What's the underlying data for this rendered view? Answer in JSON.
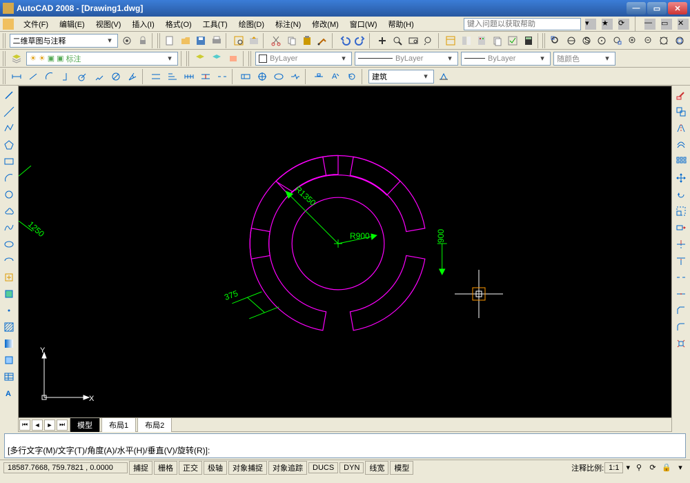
{
  "window": {
    "title": "AutoCAD 2008 - [Drawing1.dwg]",
    "help_placeholder": "键入问题以获取帮助"
  },
  "menus": [
    "文件(F)",
    "编辑(E)",
    "视图(V)",
    "插入(I)",
    "格式(O)",
    "工具(T)",
    "绘图(D)",
    "标注(N)",
    "修改(M)",
    "窗口(W)",
    "帮助(H)"
  ],
  "workspace": "二维草图与注释",
  "layers": {
    "current": "标注",
    "bylayer_color": "ByLayer",
    "bylayer_lt": "ByLayer",
    "bylayer_lw": "ByLayer",
    "followcolor": "随颜色"
  },
  "dim": {
    "style": "建筑"
  },
  "tabs": {
    "model": "模型",
    "layout1": "布局1",
    "layout2": "布局2"
  },
  "cmd": {
    "prompt": "[多行文字(M)/文字(T)/角度(A)/水平(H)/垂直(V)/旋转(R)]:"
  },
  "status": {
    "coords": "18587.7668, 759.7821 , 0.0000",
    "snap": "捕捉",
    "grid": "栅格",
    "ortho": "正交",
    "polar": "极轴",
    "osnap": "对象捕捉",
    "otrack": "对象追踪",
    "ducs": "DUCS",
    "dyn": "DYN",
    "lwt": "线宽",
    "model": "模型",
    "anno": "注释比例:",
    "scale": "1:1"
  },
  "drawing": {
    "ucs_x": "X",
    "ucs_y": "Y",
    "dims": {
      "r900": "R900",
      "r1350": "R1350",
      "d375": "375",
      "d900": "900",
      "d1250": "1250"
    }
  }
}
